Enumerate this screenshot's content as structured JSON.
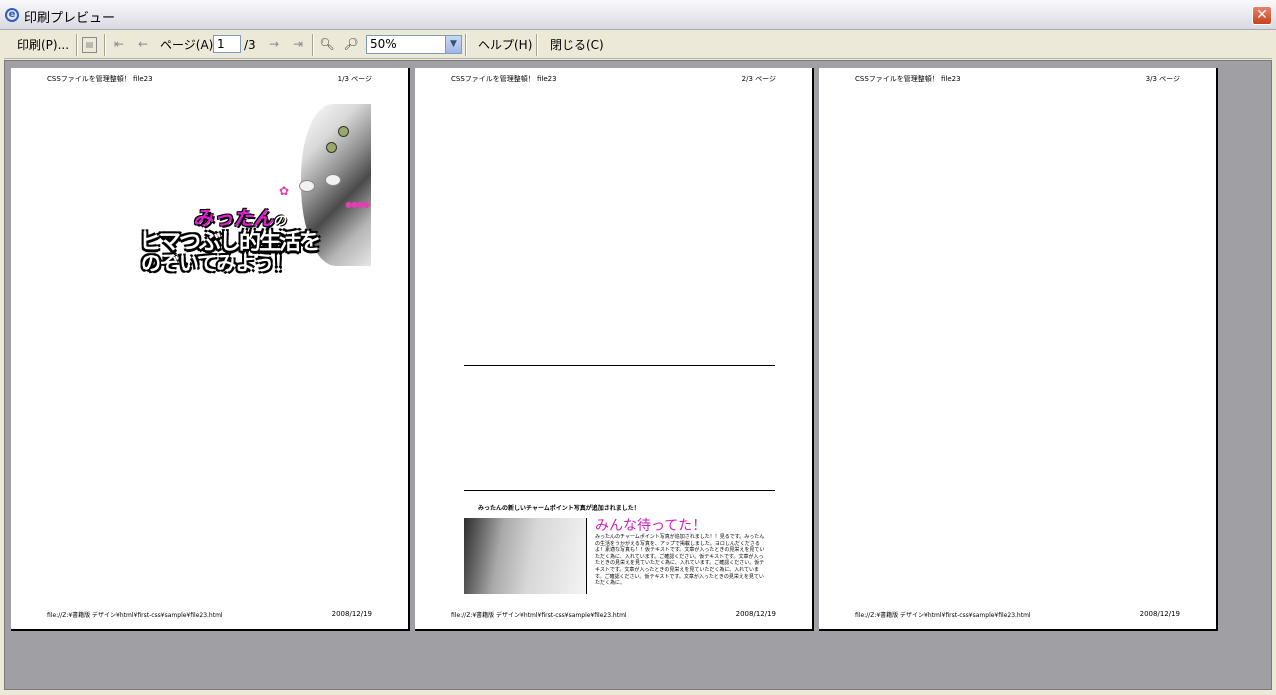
{
  "window": {
    "title": "印刷プレビュー",
    "close_label": "✕"
  },
  "toolbar": {
    "print_label": "印刷(P)...",
    "page_label": "ページ(A)",
    "page_value": "1",
    "page_total": "/3",
    "zoom_value": "50%",
    "help_label": "ヘルプ(H)",
    "close_label": "閉じる(C)"
  },
  "pages": [
    {
      "header_left": "CSSファイルを管理整頓！ file23",
      "header_right": "1/3 ページ",
      "footer_left": "file://Z:¥書籍版 デザイン¥html¥first-css¥sample¥file23.html",
      "footer_right": "2008/12/19",
      "banner": {
        "name": "みったん",
        "particle": "の",
        "line2": "ヒマつぶし的生活を",
        "line3": "のぞいてみよう！"
      }
    },
    {
      "header_left": "CSSファイルを管理整頓！ file23",
      "header_right": "2/3 ページ",
      "footer_left": "file://Z:¥書籍版 デザイン¥html¥first-css¥sample¥file23.html",
      "footer_right": "2008/12/19",
      "news": {
        "heading": "みったんの新しいチャームポイント写真が追加されました！",
        "title": "みんな待ってた！",
        "body": "みったんのチャームポイント写真が追加されました！！見るです。みったんの生活をうかがえる写真を、アップで掲載しました。ヨロしんだくださるよ！素適な写真も！！仮テキストです。文章が入ったときの見栄えを見ていただく為に、入れています。ご確認ください。仮テキストです。文章が入ったときの見栄えを見ていただく為に、入れています。ご確認ください。仮テキストです。文章が入ったときの見栄えを見ていただく為に、入れています。ご確認ください。仮テキストです。文章が入ったときの見栄えを見ていただく為に。"
      }
    },
    {
      "header_left": "CSSファイルを管理整頓！ file23",
      "header_right": "3/3 ページ",
      "footer_left": "file://Z:¥書籍版 デザイン¥html¥first-css¥sample¥file23.html",
      "footer_right": "2008/12/19"
    }
  ]
}
